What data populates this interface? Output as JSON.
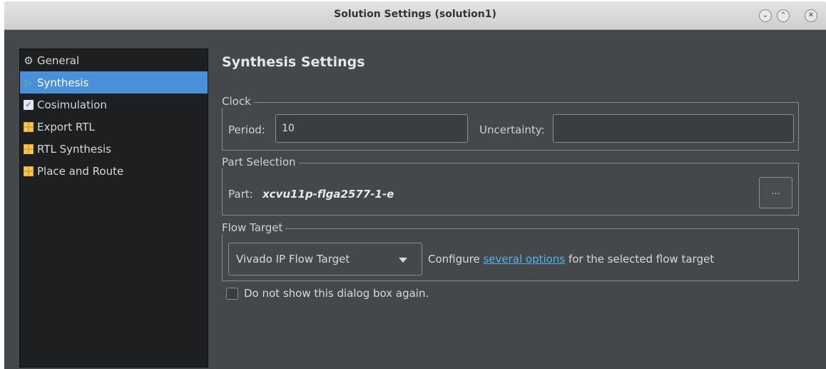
{
  "window": {
    "title": "Solution Settings (solution1)",
    "buttons": [
      "minimize",
      "maximize",
      "close"
    ]
  },
  "sidebar": {
    "items": [
      {
        "label": "General",
        "icon": "gear-icon"
      },
      {
        "label": "Synthesis",
        "icon": "play-icon",
        "selected": true
      },
      {
        "label": "Cosimulation",
        "icon": "checkbox-icon"
      },
      {
        "label": "Export RTL",
        "icon": "grid-icon"
      },
      {
        "label": "RTL Synthesis",
        "icon": "grid-icon"
      },
      {
        "label": "Place and Route",
        "icon": "grid-icon"
      }
    ]
  },
  "main": {
    "heading": "Synthesis Settings",
    "clock": {
      "group_label": "Clock",
      "period_label": "Period:",
      "period_value": "10",
      "uncertainty_label": "Uncertainty:",
      "uncertainty_value": ""
    },
    "part": {
      "group_label": "Part Selection",
      "part_label": "Part:",
      "part_value": "xcvu11p-flga2577-1-e",
      "browse_label": "..."
    },
    "flow": {
      "group_label": "Flow Target",
      "selected": "Vivado IP Flow Target",
      "text_before": "Configure ",
      "link_text": "several options",
      "text_after": " for the selected flow target"
    },
    "dont_show_label": "Do not show this dialog box again."
  },
  "colors": {
    "background": "#45484b",
    "sidebar_bg": "#1e1f21",
    "selection": "#4a90d9",
    "link": "#5ab0ea"
  }
}
